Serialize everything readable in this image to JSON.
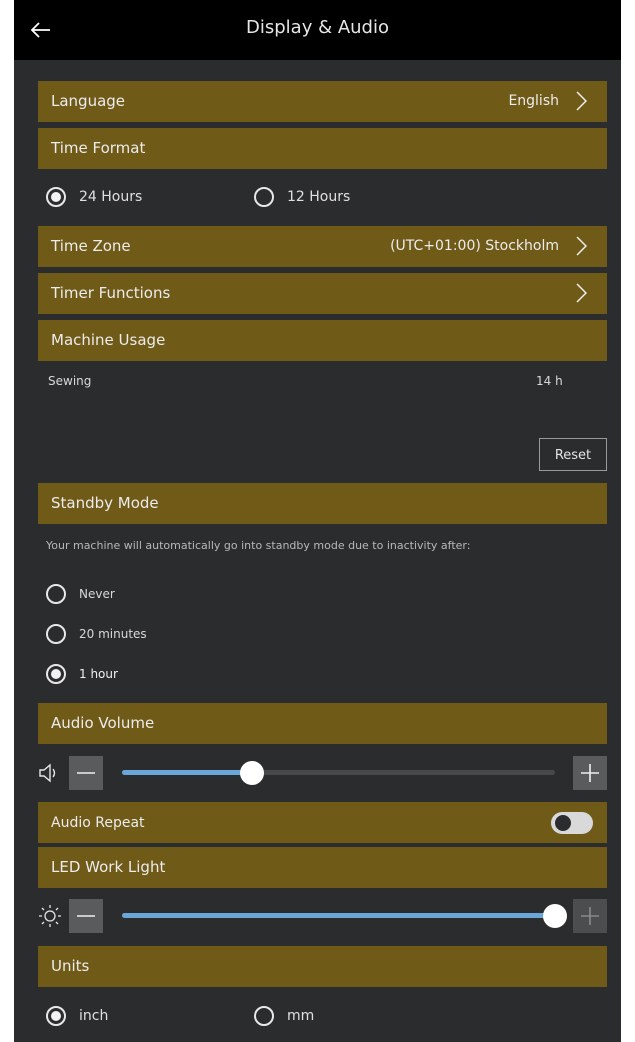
{
  "header": {
    "title": "Display & Audio",
    "back_icon": "arrow-left-icon"
  },
  "language": {
    "label": "Language",
    "value": "English"
  },
  "time_format": {
    "label": "Time Format",
    "options": [
      {
        "label": "24 Hours",
        "selected": true
      },
      {
        "label": "12 Hours",
        "selected": false
      }
    ]
  },
  "time_zone": {
    "label": "Time Zone",
    "value": "(UTC+01:00) Stockholm"
  },
  "timer_functions": {
    "label": "Timer Functions"
  },
  "machine_usage": {
    "label": "Machine Usage",
    "rows": [
      {
        "name": "Sewing",
        "value": "14 h"
      }
    ],
    "reset_label": "Reset"
  },
  "standby": {
    "label": "Standby Mode",
    "description": "Your machine will automatically go into standby mode due to inactivity after:",
    "options": [
      {
        "label": "Never",
        "selected": false
      },
      {
        "label": "20 minutes",
        "selected": false
      },
      {
        "label": "1 hour",
        "selected": true
      }
    ]
  },
  "audio_volume": {
    "label": "Audio Volume",
    "level_fraction": 0.3,
    "icon": "speaker-icon"
  },
  "audio_repeat": {
    "label": "Audio Repeat",
    "enabled": false
  },
  "led_work_light": {
    "label": "LED Work Light",
    "level_fraction": 1.0,
    "icon": "brightness-icon"
  },
  "units": {
    "label": "Units",
    "options": [
      {
        "label": "inch",
        "selected": true
      },
      {
        "label": "mm",
        "selected": false
      }
    ]
  },
  "colors": {
    "section_bar": "#6f5a18",
    "background": "#2b2c2e",
    "slider_fill": "#6aa6d8",
    "topbar": "#000000"
  }
}
